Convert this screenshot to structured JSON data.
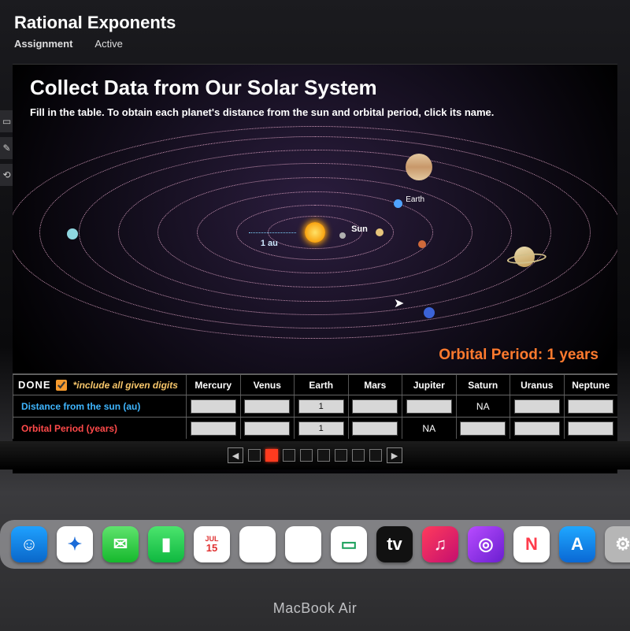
{
  "header": {
    "title": "Rational Exponents",
    "tabs": [
      {
        "label": "Assignment",
        "active": true
      },
      {
        "label": "Active",
        "active": false
      }
    ]
  },
  "lesson": {
    "title": "Collect Data from Our Solar System",
    "instruction": "Fill in the table. To obtain each planet's distance from the sun and orbital period, click its name.",
    "sun_label": "Sun",
    "au_label": "1 au",
    "earth_label": "Earth",
    "readout_label": "Orbital Period:",
    "readout_value": "1 years"
  },
  "planets": [
    "Mercury",
    "Venus",
    "Earth",
    "Mars",
    "Jupiter",
    "Saturn",
    "Uranus",
    "Neptune"
  ],
  "table": {
    "done_label": "DONE",
    "note": "*include all given digits",
    "rows": [
      {
        "label": "Distance from the sun (au)",
        "cells": [
          {
            "type": "input",
            "value": ""
          },
          {
            "type": "input",
            "value": ""
          },
          {
            "type": "input",
            "value": "1"
          },
          {
            "type": "input",
            "value": ""
          },
          {
            "type": "input",
            "value": ""
          },
          {
            "type": "text",
            "value": "NA"
          },
          {
            "type": "input",
            "value": ""
          },
          {
            "type": "input",
            "value": ""
          }
        ]
      },
      {
        "label": "Orbital Period (years)",
        "cells": [
          {
            "type": "input",
            "value": ""
          },
          {
            "type": "input",
            "value": ""
          },
          {
            "type": "input",
            "value": "1"
          },
          {
            "type": "input",
            "value": ""
          },
          {
            "type": "text",
            "value": "NA"
          },
          {
            "type": "input",
            "value": ""
          },
          {
            "type": "input",
            "value": ""
          },
          {
            "type": "input",
            "value": ""
          }
        ]
      }
    ]
  },
  "pager": {
    "total": 8,
    "current": 2
  },
  "dock": {
    "calendar_month": "JUL",
    "calendar_day": "15",
    "tv_label": "tv"
  },
  "bezel": "MacBook Air"
}
